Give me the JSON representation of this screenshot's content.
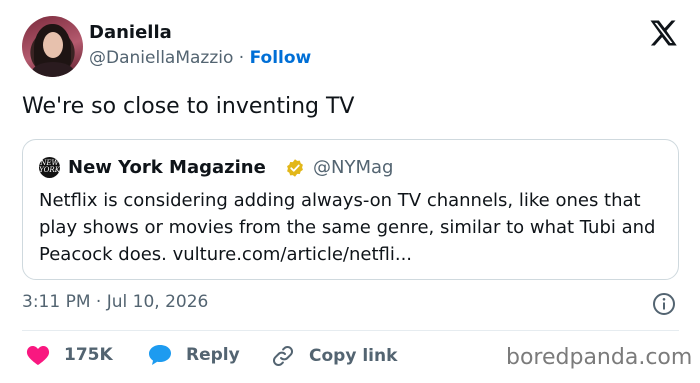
{
  "author": {
    "name": "Daniella",
    "handle": "@DaniellaMazzio",
    "separator": " · ",
    "follow_label": "Follow"
  },
  "tweet": {
    "text": "We're so close to inventing TV"
  },
  "quoted": {
    "name": "New York Magazine",
    "handle": "@NYMag",
    "logo_text": "NEW YORK",
    "body": "Netflix is considering adding always-on TV channels, like ones that play shows or movies from the same genre, similar to what Tubi and Peacock does. vulture.com/article/netfli..."
  },
  "meta": {
    "timestamp": "3:11 PM · Jul 10, 2026"
  },
  "actions": {
    "like_count": "175K",
    "reply_label": "Reply",
    "copy_label": "Copy link"
  },
  "watermark": "boredpanda.com",
  "colors": {
    "link": "#006fd6",
    "heart": "#f91880",
    "reply": "#1d9bf0",
    "verified": "#e2b719",
    "muted": "#536471"
  },
  "icons": [
    "x-logo-icon",
    "verified-badge-icon",
    "info-icon",
    "heart-icon",
    "reply-icon",
    "link-icon"
  ]
}
